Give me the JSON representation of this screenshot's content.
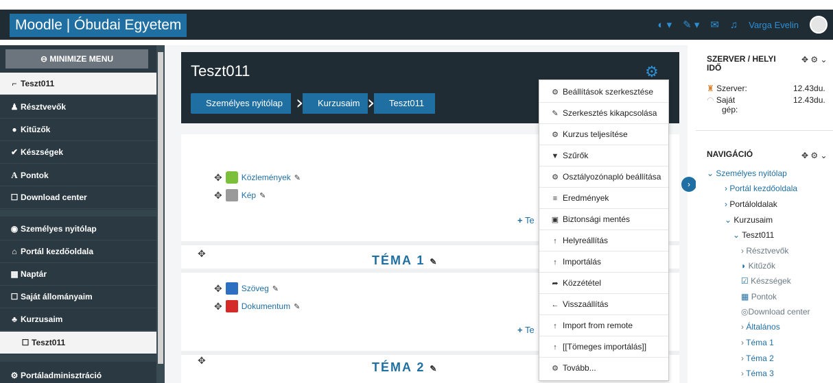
{
  "header": {
    "brand": "Moodle | Óbudai Egyetem",
    "user_name": "Varga Evelin",
    "icons": [
      "globe-icon",
      "paintbrush-icon",
      "envelope-icon",
      "bell-icon"
    ]
  },
  "sidebar": {
    "minimize_label": "MINIMIZE MENU",
    "items": [
      {
        "label": "Teszt011",
        "icon": "graduation-cap-icon",
        "glyph": "🎓"
      },
      {
        "label": "Résztvevők",
        "icon": "users-icon",
        "glyph": "👥"
      },
      {
        "label": "Kitűzők",
        "icon": "badge-icon",
        "glyph": "●"
      },
      {
        "label": "Készségek",
        "icon": "check-circle-icon",
        "glyph": "✔"
      },
      {
        "label": "Pontok",
        "icon": "grade-icon",
        "glyph": "A"
      },
      {
        "label": "Download center",
        "icon": "folder-icon",
        "glyph": "☐"
      },
      {
        "label": "Személyes nyitólap",
        "icon": "dashboard-icon",
        "glyph": "◉"
      },
      {
        "label": "Portál kezdőoldala",
        "icon": "home-icon",
        "glyph": "⌂"
      },
      {
        "label": "Naptár",
        "icon": "calendar-icon",
        "glyph": "▦"
      },
      {
        "label": "Saját állományaim",
        "icon": "folder-icon",
        "glyph": "☐"
      },
      {
        "label": "Kurzusaim",
        "icon": "sitemap-icon",
        "glyph": "♣"
      },
      {
        "label": "Teszt011",
        "icon": "folder-icon",
        "glyph": "☐"
      },
      {
        "label": "Portáladminisztráció",
        "icon": "cogs-icon",
        "glyph": "⚙"
      }
    ]
  },
  "course": {
    "title": "Teszt011",
    "breadcrumb": [
      "Személyes nyitólap",
      "Kurzusaim",
      "Teszt011"
    ]
  },
  "sections": {
    "general_activities": [
      "Közlemények",
      "Kép"
    ],
    "topic1_title": "TÉMA 1",
    "topic1_activities": [
      "Szöveg",
      "Dokumentum"
    ],
    "topic2_title": "TÉMA 2",
    "add_label": "Te"
  },
  "dropdown": [
    {
      "label": "Beállítások szerkesztése",
      "icon": "cog-icon",
      "glyph": "⚙"
    },
    {
      "label": "Szerkesztés kikapcsolása",
      "icon": "pencil-icon",
      "glyph": "✎"
    },
    {
      "label": "Kurzus teljesítése",
      "icon": "cog-icon",
      "glyph": "⚙"
    },
    {
      "label": "Szűrők",
      "icon": "filter-icon",
      "glyph": "▼"
    },
    {
      "label": "Osztályozónapló beállítása",
      "icon": "cog-icon",
      "glyph": "⚙"
    },
    {
      "label": "Eredmények",
      "icon": "list-icon",
      "glyph": "≡"
    },
    {
      "label": "Biztonsági mentés",
      "icon": "backup-icon",
      "glyph": "▣"
    },
    {
      "label": "Helyreállítás",
      "icon": "upload-icon",
      "glyph": "↑"
    },
    {
      "label": "Importálás",
      "icon": "upload-icon",
      "glyph": "↑"
    },
    {
      "label": "Közzététel",
      "icon": "share-icon",
      "glyph": "➦"
    },
    {
      "label": "Visszaállítás",
      "icon": "arrow-left-icon",
      "glyph": "←"
    },
    {
      "label": "Import from remote",
      "icon": "upload-icon",
      "glyph": "↑"
    },
    {
      "label": "[[Tömeges importálás]]",
      "icon": "upload-icon",
      "glyph": "↑"
    },
    {
      "label": "Tovább...",
      "icon": "cog-icon",
      "glyph": "⚙"
    }
  ],
  "time_block": {
    "title": "SZERVER / HELYI IDŐ",
    "server_label": "Szerver:",
    "server_time": "12.43du.",
    "local_label_1": "Saját",
    "local_label_2": "gép:",
    "local_time": "12.43du."
  },
  "nav_block": {
    "title": "NAVIGÁCIÓ",
    "items": [
      {
        "label": "Személyes nyitólap",
        "prefix": "⌄"
      },
      {
        "label": "Portál kezdőoldala",
        "prefix": "›"
      },
      {
        "label": "Portáloldalak",
        "prefix": "›"
      },
      {
        "label": "Kurzusaim",
        "prefix": "⌄"
      },
      {
        "label": "Teszt011",
        "prefix": "⌄"
      },
      {
        "label": "Résztvevők",
        "prefix": "›"
      },
      {
        "label": "Kitűzők",
        "prefix": "◗"
      },
      {
        "label": "Készségek",
        "prefix": "☑"
      },
      {
        "label": "Pontok",
        "prefix": "▦"
      },
      {
        "label": "Download center",
        "prefix": "◎"
      },
      {
        "label": "Általános",
        "prefix": "›"
      },
      {
        "label": "Téma 1",
        "prefix": "›"
      },
      {
        "label": "Téma 2",
        "prefix": "›"
      },
      {
        "label": "Téma 3",
        "prefix": "›"
      }
    ]
  },
  "colors": {
    "navbar": "#202c33",
    "brand": "#1f6fa3",
    "accent": "#2d8fd5",
    "sidebar": "#2b3a42"
  }
}
